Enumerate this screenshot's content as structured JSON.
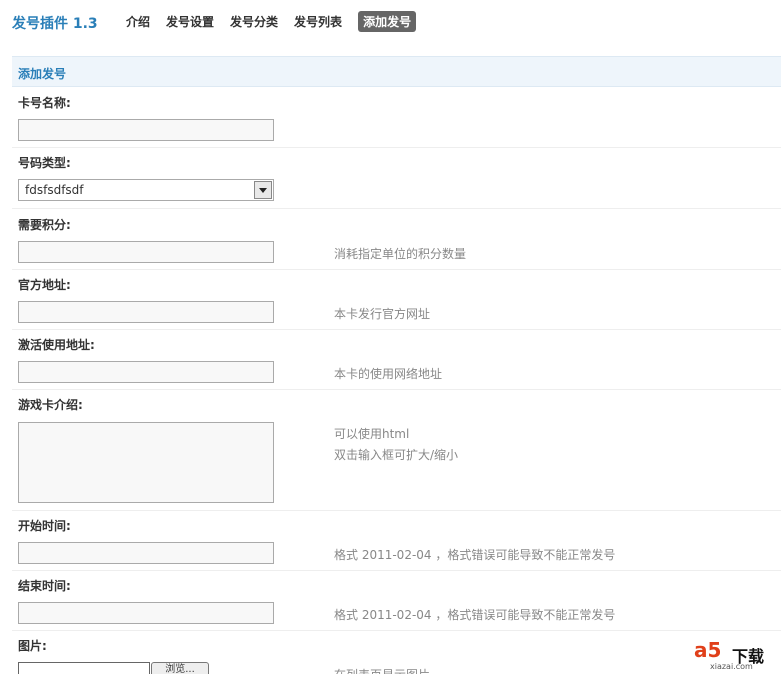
{
  "header": {
    "brand": "发号插件 1.3",
    "nav": [
      "介绍",
      "发号设置",
      "发号分类",
      "发号列表",
      "添加发号"
    ],
    "active_index": 4
  },
  "section": {
    "title": "添加发号"
  },
  "form": {
    "card_name": {
      "label": "卡号名称:",
      "value": ""
    },
    "number_type": {
      "label": "号码类型:",
      "selected": "fdsfsdfsdf"
    },
    "points": {
      "label": "需要积分:",
      "hint": "消耗指定单位的积分数量"
    },
    "official_url": {
      "label": "官方地址:",
      "hint": "本卡发行官方网址"
    },
    "activate_url": {
      "label": "激活使用地址:",
      "hint": "本卡的使用网络地址"
    },
    "intro": {
      "label": "游戏卡介绍:",
      "hint1": "可以使用html",
      "hint2": "双击输入框可扩大/缩小"
    },
    "start_time": {
      "label": "开始时间:",
      "hint": "格式 2011-02-04 ，格式错误可能导致不能正常发号"
    },
    "end_time": {
      "label": "结束时间:",
      "hint": "格式 2011-02-04 ，格式错误可能导致不能正常发号"
    },
    "image": {
      "label": "图片:",
      "button": "浏览...",
      "hint": "在列表页显示图片"
    }
  },
  "watermark": {
    "brand": "a5",
    "text": "下载",
    "domain": "xiazai.com"
  },
  "colors": {
    "accent": "#2a7fb8",
    "active_tab": "#666666",
    "section_bg": "#eef5fb",
    "hint": "#888888"
  }
}
